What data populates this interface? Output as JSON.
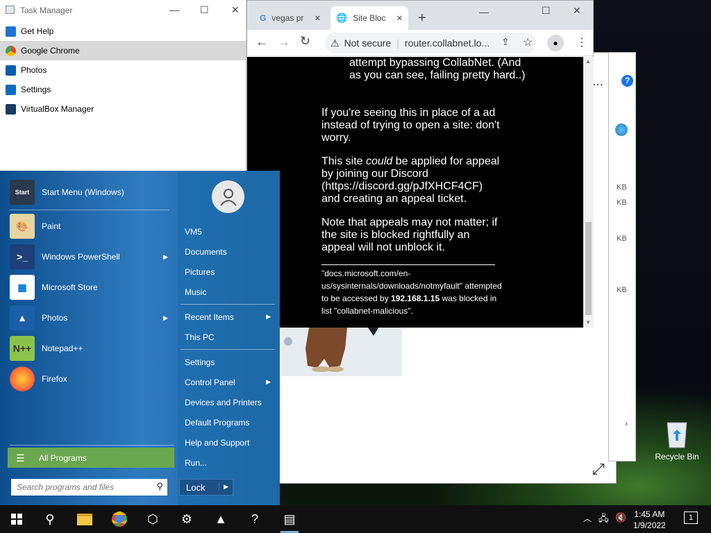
{
  "task_manager": {
    "title": "Task Manager",
    "items": [
      "Get Help",
      "Google Chrome",
      "Photos",
      "Settings",
      "VirtualBox Manager"
    ],
    "selected": "Google Chrome"
  },
  "chrome": {
    "tabs": [
      {
        "title": "vegas pr"
      },
      {
        "title": "Site Bloc"
      }
    ],
    "security": "Not secure",
    "url": "router.collabnet.lo...",
    "page": {
      "p0": "attempt bypassing CollabNet. (And as you can see, failing pretty hard..)",
      "p1": "If you're seeing this in place of a ad instead of trying to open a site: don't worry.",
      "p2_a": "This site ",
      "p2_em": "could",
      "p2_b": " be applied for appeal by joining our Discord (https://discord.gg/pJfXHCF4CF) and creating an appeal ticket.",
      "p3": "Note that appeals may not matter; if the site is blocked rightfully an appeal will not unblock it.",
      "blocked_url": "\"docs.microsoft.com/en-us/sysinternals/downloads/notmyfault\"",
      "blocked_mid": " attempted to be accessed by ",
      "ip": "192.168.1.15",
      "blocked_tail": " was blocked in list ",
      "list": "\"collabnet-malicious\"."
    }
  },
  "bg_window": {
    "sizes": [
      "KB",
      "KB",
      "KB",
      "KB"
    ]
  },
  "start_menu": {
    "programs": [
      {
        "label": "Start Menu (Windows)",
        "icon": "start-menu-icon",
        "color": "#2b3a4a"
      },
      {
        "label": "Paint",
        "icon": "paint-icon",
        "color": "#e8d4a0"
      },
      {
        "label": "Windows PowerShell",
        "icon": "powershell-icon",
        "color": "#1e3f7a",
        "arrow": true
      },
      {
        "label": "Microsoft Store",
        "icon": "store-icon",
        "color": "#ffffff"
      },
      {
        "label": "Photos",
        "icon": "photos-icon",
        "color": "#1a5fa8",
        "arrow": true
      },
      {
        "label": "Notepad++",
        "icon": "notepadpp-icon",
        "color": "#8bc34a"
      },
      {
        "label": "Firefox",
        "icon": "firefox-icon",
        "color": "#ff7139"
      }
    ],
    "right": [
      "VM5",
      "Documents",
      "Pictures",
      "Music",
      "Recent Items",
      "This PC",
      "Settings",
      "Control Panel",
      "Devices and Printers",
      "Default Programs",
      "Help and Support",
      "Run..."
    ],
    "all_programs": "All Programs",
    "search_placeholder": "Search programs and files",
    "lock": "Lock"
  },
  "desktop": {
    "recycle_bin": "Recycle Bin"
  },
  "taskbar": {
    "time": "1:45 AM",
    "date": "1/9/2022",
    "notifications": "1"
  }
}
